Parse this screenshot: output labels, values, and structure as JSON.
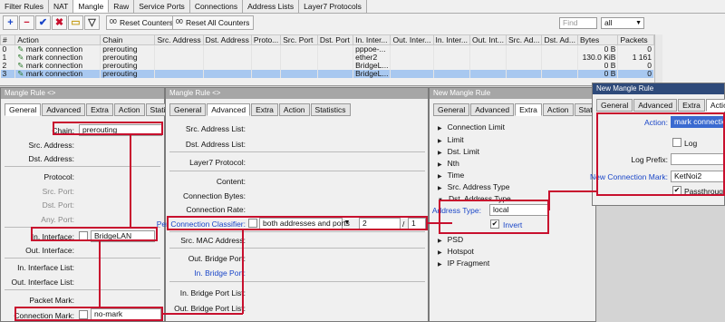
{
  "top": {
    "tabs": [
      "Filter Rules",
      "NAT",
      "Mangle",
      "Raw",
      "Service Ports",
      "Connections",
      "Address Lists",
      "Layer7 Protocols"
    ],
    "active_tab": 2,
    "toolbar": {
      "add": "+",
      "remove": "−",
      "enable": "✔",
      "disable": "✖",
      "comment": "▭",
      "filter": "▽",
      "reset_counters": "Reset Counters",
      "reset_all": "Reset All Counters",
      "find_placeholder": "Find",
      "scope": "all"
    },
    "columns": [
      "#",
      "Action",
      "Chain",
      "Src. Address",
      "Dst. Address",
      "Proto...",
      "Src. Port",
      "Dst. Port",
      "In. Inter...",
      "Out. Inter...",
      "In. Inter...",
      "Out. Int...",
      "Src. Ad...",
      "Dst. Ad...",
      "Bytes",
      "Packets"
    ],
    "rows": [
      {
        "num": "0",
        "action": "mark connection",
        "chain": "prerouting",
        "in_iface": "pppoe-...",
        "bytes": "0 B",
        "packets": "0"
      },
      {
        "num": "1",
        "action": "mark connection",
        "chain": "prerouting",
        "in_iface": "ether2",
        "bytes": "130.0 KiB",
        "packets": "1 161"
      },
      {
        "num": "2",
        "action": "mark connection",
        "chain": "prerouting",
        "in_iface": "BridgeL...",
        "bytes": "0 B",
        "packets": "0"
      },
      {
        "num": "3",
        "action": "mark connection",
        "chain": "prerouting",
        "in_iface": "BridgeL...",
        "bytes": "0 B",
        "packets": "0"
      }
    ]
  },
  "win1": {
    "title": "Mangle Rule <>",
    "tabs": [
      "General",
      "Advanced",
      "Extra",
      "Action",
      "Statistics"
    ],
    "chain_label": "Chain:",
    "chain_value": "prerouting",
    "src_address": "Src. Address:",
    "dst_address": "Dst. Address:",
    "protocol": "Protocol:",
    "src_port": "Src. Port:",
    "dst_port": "Dst. Port:",
    "any_port": "Any. Port:",
    "in_interface": "In. Interface:",
    "in_interface_value": "BridgeLAN",
    "out_interface": "Out. Interface:",
    "in_interface_list": "In. Interface List:",
    "out_interface_list": "Out. Interface List:",
    "packet_mark": "Packet Mark:",
    "connection_mark": "Connection Mark:",
    "connection_mark_value": "no-mark"
  },
  "win2": {
    "title": "Mangle Rule <>",
    "tabs": [
      "General",
      "Advanced",
      "Extra",
      "Action",
      "Statistics"
    ],
    "src_address_list": "Src. Address List:",
    "dst_address_list": "Dst. Address List:",
    "layer7": "Layer7 Protocol:",
    "content": "Content:",
    "connection_bytes": "Connection Bytes:",
    "connection_rate": "Connection Rate:",
    "pcc": "Per Connection Classifier:",
    "pcc_value": "both addresses and ports",
    "pcc_num": "2",
    "pcc_slash": "/",
    "pcc_den": "1",
    "src_mac": "Src. MAC Address:",
    "out_bridge_port": "Out. Bridge Port:",
    "in_bridge_port": "In. Bridge Port:",
    "in_bridge_port_list": "In. Bridge Port List:",
    "out_bridge_port_list": "Out. Bridge Port List:"
  },
  "win3": {
    "title": "New Mangle Rule",
    "tabs": [
      "General",
      "Advanced",
      "Extra",
      "Action",
      "Statistics"
    ],
    "items": [
      "Connection Limit",
      "Limit",
      "Dst. Limit",
      "Nth",
      "Time",
      "Src. Address Type",
      "Dst. Address Type"
    ],
    "address_type_label": "Address Type:",
    "address_type_value": "local",
    "invert": "Invert",
    "items2": [
      "PSD",
      "Hotspot",
      "IP Fragment"
    ]
  },
  "win4": {
    "title": "New Mangle Rule",
    "tabs": [
      "General",
      "Advanced",
      "Extra",
      "Action"
    ],
    "action_label": "Action:",
    "action_value": "mark connection",
    "log": "Log",
    "log_prefix": "Log Prefix:",
    "new_connection_mark": "New Connection Mark:",
    "new_connection_mark_value": "KetNoi2",
    "passthrough": "Passthrough"
  },
  "colors": {
    "highlight": "#c8102e",
    "link_blue": "#1a46c8",
    "selection": "#a8c8f0"
  }
}
